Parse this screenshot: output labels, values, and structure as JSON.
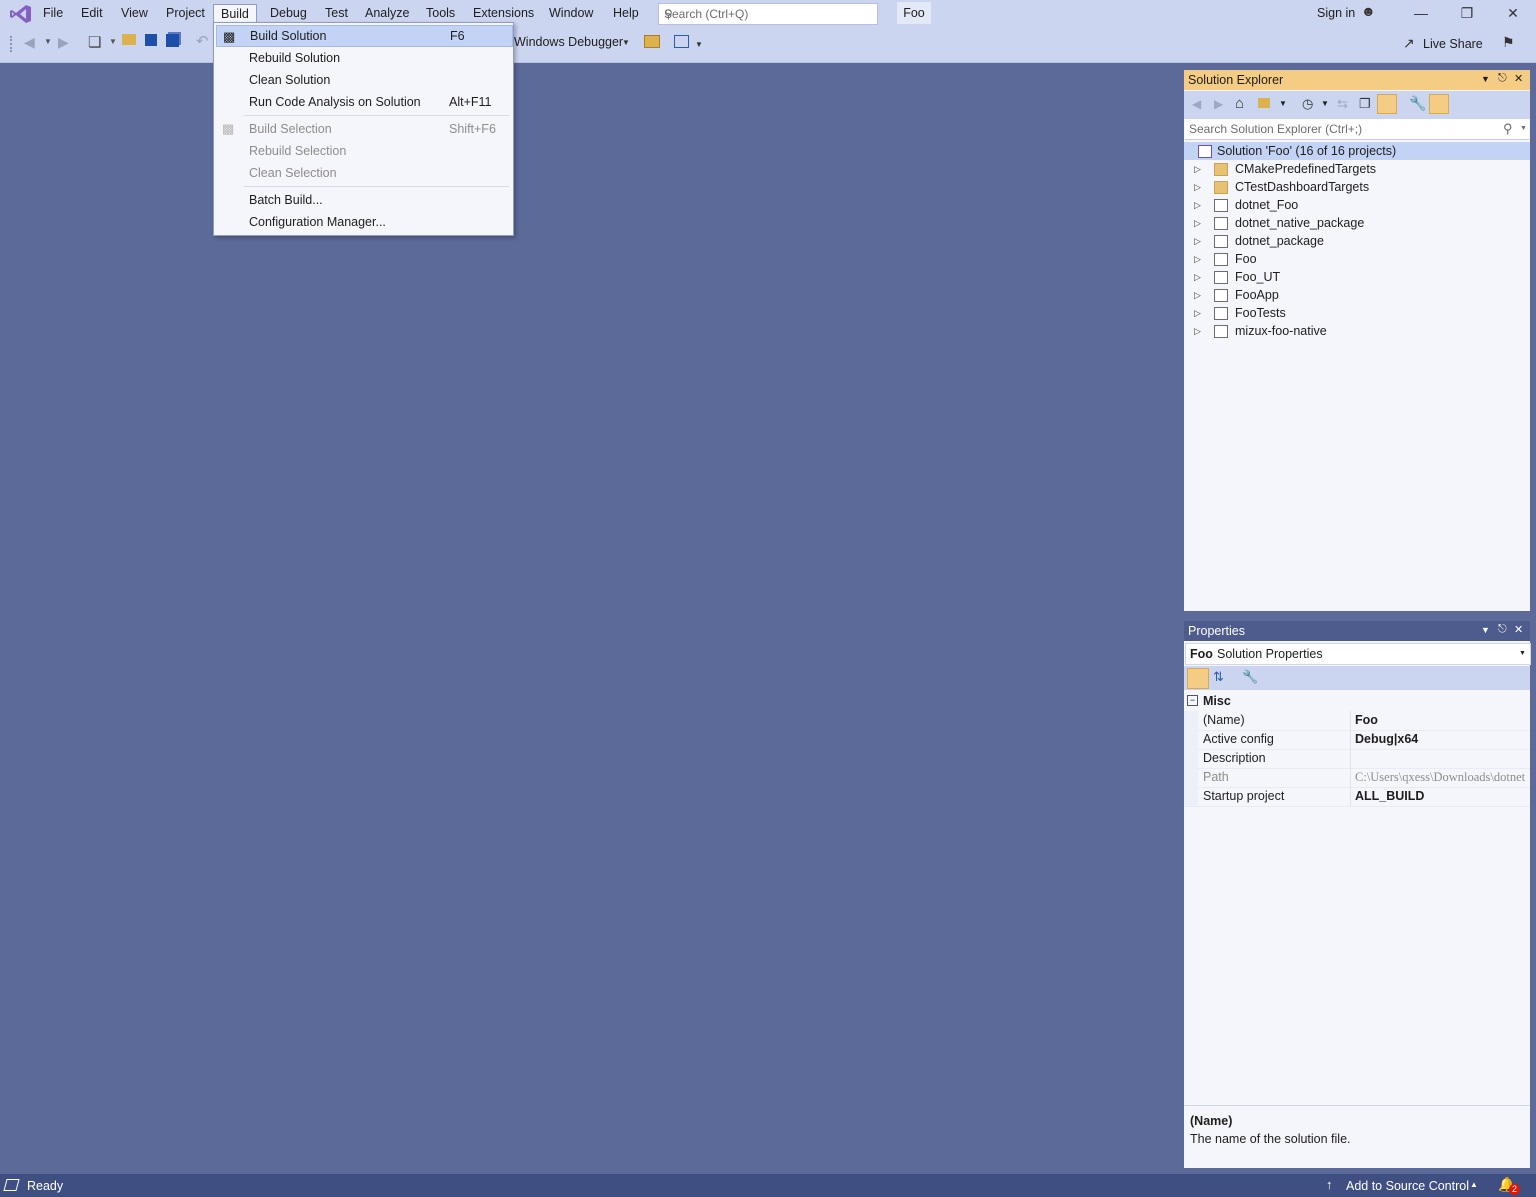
{
  "menubar": {
    "items": [
      "File",
      "Edit",
      "View",
      "Project",
      "Build",
      "Debug",
      "Test",
      "Analyze",
      "Tools",
      "Extensions",
      "Window",
      "Help"
    ],
    "search_placeholder": "Search (Ctrl+Q)",
    "solution_name": "Foo",
    "sign_in": "Sign in",
    "minimize": "—",
    "restore": "❐",
    "close": "✕"
  },
  "toolbar": {
    "debugger_label": "Windows Debugger",
    "live_share": "Live Share"
  },
  "build_menu": {
    "items": [
      {
        "label": "Build Solution",
        "shortcut": "F6"
      },
      {
        "label": "Rebuild Solution",
        "shortcut": ""
      },
      {
        "label": "Clean Solution",
        "shortcut": ""
      },
      {
        "label": "Run Code Analysis on Solution",
        "shortcut": "Alt+F11"
      },
      {
        "label": "Build Selection",
        "shortcut": "Shift+F6"
      },
      {
        "label": "Rebuild Selection",
        "shortcut": ""
      },
      {
        "label": "Clean Selection",
        "shortcut": ""
      },
      {
        "label": "Batch Build...",
        "shortcut": ""
      },
      {
        "label": "Configuration Manager...",
        "shortcut": ""
      }
    ]
  },
  "solution_explorer": {
    "title": "Solution Explorer",
    "search_placeholder": "Search Solution Explorer (Ctrl+;)",
    "root": "Solution 'Foo' (16 of 16 projects)",
    "items": [
      "CMakePredefinedTargets",
      "CTestDashboardTargets",
      "dotnet_Foo",
      "dotnet_native_package",
      "dotnet_package",
      "Foo",
      "Foo_UT",
      "FooApp",
      "FooTests",
      "mizux-foo-native"
    ]
  },
  "properties": {
    "title": "Properties",
    "object_name": "Foo",
    "object_type": "Solution Properties",
    "category": "Misc",
    "rows": [
      {
        "key": "(Name)",
        "value": "Foo"
      },
      {
        "key": "Active config",
        "value": "Debug|x64"
      },
      {
        "key": "Description",
        "value": ""
      },
      {
        "key": "Path",
        "value": "C:\\Users\\qxess\\Downloads\\dotnet"
      },
      {
        "key": "Startup project",
        "value": "ALL_BUILD"
      }
    ],
    "desc_title": "(Name)",
    "desc_text": "The name of the solution file."
  },
  "statusbar": {
    "status": "Ready",
    "source_control": "Add to Source Control",
    "notifications": "2"
  }
}
